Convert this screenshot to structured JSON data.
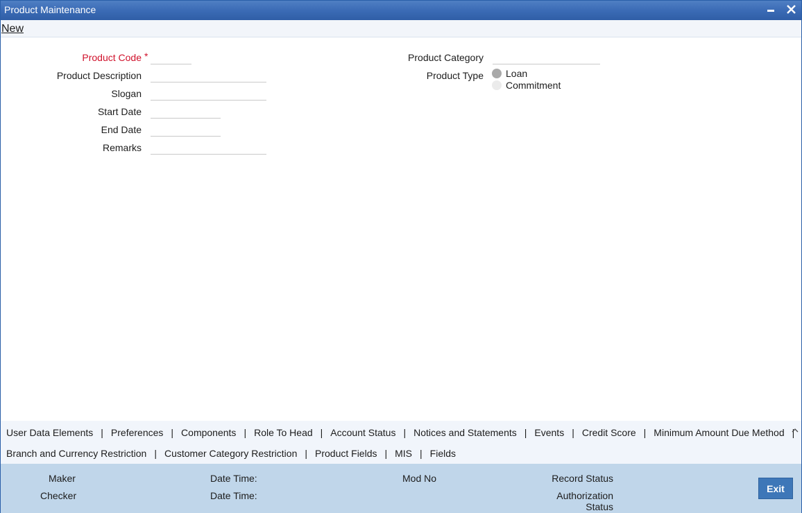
{
  "window": {
    "title": "Product Maintenance"
  },
  "menu": {
    "new_label": "New"
  },
  "form": {
    "product_code": {
      "label": "Product Code",
      "required_marker": "*",
      "value": ""
    },
    "product_description": {
      "label": "Product Description",
      "value": ""
    },
    "slogan": {
      "label": "Slogan",
      "value": ""
    },
    "start_date": {
      "label": "Start Date",
      "value": ""
    },
    "end_date": {
      "label": "End Date",
      "value": ""
    },
    "remarks": {
      "label": "Remarks",
      "value": ""
    },
    "product_category": {
      "label": "Product Category",
      "value": ""
    },
    "product_type": {
      "label": "Product Type",
      "options": [
        {
          "label": "Loan",
          "selected": true
        },
        {
          "label": "Commitment",
          "selected": false
        }
      ]
    }
  },
  "tabs": {
    "row1": [
      "User Data Elements",
      "Preferences",
      "Components",
      "Role To Head",
      "Account Status",
      "Notices and Statements",
      "Events",
      "Credit Score",
      "Minimum Amount Due Method"
    ],
    "row2": [
      "Branch and Currency Restriction",
      "Customer Category Restriction",
      "Product Fields",
      "MIS",
      "Fields"
    ],
    "separator": "|"
  },
  "footer": {
    "maker": "Maker",
    "checker": "Checker",
    "date_time_1": "Date Time:",
    "date_time_2": "Date Time:",
    "mod_no": "Mod No",
    "record_status": "Record Status",
    "authorization_status_line1": "Authorization",
    "authorization_status_line2": "Status",
    "exit_label": "Exit"
  },
  "colors": {
    "titlebar": "#3a6ab4",
    "required": "#d0112b",
    "footer": "#c0d6ea",
    "exit_button": "#3e77b8"
  }
}
